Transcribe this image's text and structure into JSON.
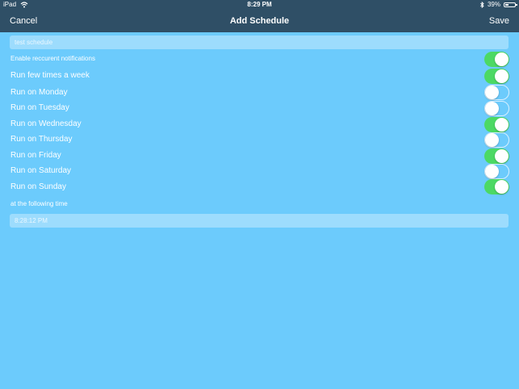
{
  "status_bar": {
    "device": "iPad",
    "time": "8:29 PM",
    "battery_percent": "39%",
    "battery_level": 0.39
  },
  "nav": {
    "cancel_label": "Cancel",
    "title": "Add Schedule",
    "save_label": "Save"
  },
  "schedule_name": {
    "value": "test schedule"
  },
  "toggles": [
    {
      "label": "Enable reccurent notifications",
      "on": true
    },
    {
      "label": "Run few times a week",
      "on": true
    },
    {
      "label": "Run on Monday",
      "on": false
    },
    {
      "label": "Run on Tuesday",
      "on": false
    },
    {
      "label": "Run on Wednesday",
      "on": true
    },
    {
      "label": "Run on Thursday",
      "on": false
    },
    {
      "label": "Run on Friday",
      "on": true
    },
    {
      "label": "Run on Saturday",
      "on": false
    },
    {
      "label": "Run on Sunday",
      "on": true
    }
  ],
  "time_section": {
    "label": "at the following time",
    "value": "8:28:12 PM"
  },
  "colors": {
    "background": "#6ccbfc",
    "bar": "#2f4f66",
    "toggle_on": "#4cd964",
    "field": "#9ddcfd"
  },
  "icons": {
    "wifi": "wifi-icon",
    "bluetooth": "bluetooth-icon",
    "battery": "battery-icon"
  }
}
